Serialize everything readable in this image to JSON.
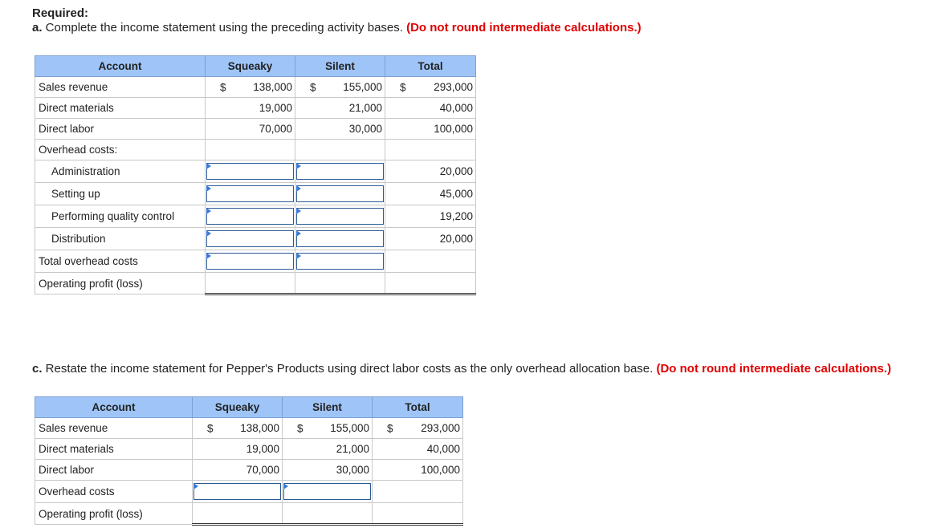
{
  "header": {
    "required": "Required:",
    "part_a_prefix": "a.",
    "part_a_text": " Complete the income statement using the preceding activity bases. ",
    "part_a_note": "(Do not round intermediate calculations.)",
    "part_c_prefix": "c.",
    "part_c_text": " Restate the income statement for Pepper's Products using direct labor costs as the only overhead allocation base. ",
    "part_c_note": "(Do not round intermediate calculations.)"
  },
  "table_a": {
    "headers": [
      "Account",
      "Squeaky",
      "Silent",
      "Total"
    ],
    "currency": "$",
    "rows": {
      "sales": {
        "label": "Sales revenue",
        "squeaky": "138,000",
        "silent": "155,000",
        "total": "293,000"
      },
      "materials": {
        "label": "Direct materials",
        "squeaky": "19,000",
        "silent": "21,000",
        "total": "40,000"
      },
      "labor": {
        "label": "Direct labor",
        "squeaky": "70,000",
        "silent": "30,000",
        "total": "100,000"
      },
      "overhead": {
        "label": "Overhead costs:"
      },
      "admin": {
        "label": "Administration",
        "total": "20,000"
      },
      "setup": {
        "label": "Setting up",
        "total": "45,000"
      },
      "quality": {
        "label": "Performing quality control",
        "total": "19,200"
      },
      "distribution": {
        "label": "Distribution",
        "total": "20,000"
      },
      "total_overhead": {
        "label": "Total overhead costs"
      },
      "profit": {
        "label": "Operating profit (loss)"
      }
    }
  },
  "table_c": {
    "headers": [
      "Account",
      "Squeaky",
      "Silent",
      "Total"
    ],
    "currency": "$",
    "rows": {
      "sales": {
        "label": "Sales revenue",
        "squeaky": "138,000",
        "silent": "155,000",
        "total": "293,000"
      },
      "materials": {
        "label": "Direct materials",
        "squeaky": "19,000",
        "silent": "21,000",
        "total": "40,000"
      },
      "labor": {
        "label": "Direct labor",
        "squeaky": "70,000",
        "silent": "30,000",
        "total": "100,000"
      },
      "overhead": {
        "label": "Overhead costs"
      },
      "profit": {
        "label": "Operating profit (loss)"
      }
    }
  },
  "colors": {
    "header_bg": "#9fc5f8",
    "note_red": "#e00000",
    "input_border": "#2c5a96"
  }
}
